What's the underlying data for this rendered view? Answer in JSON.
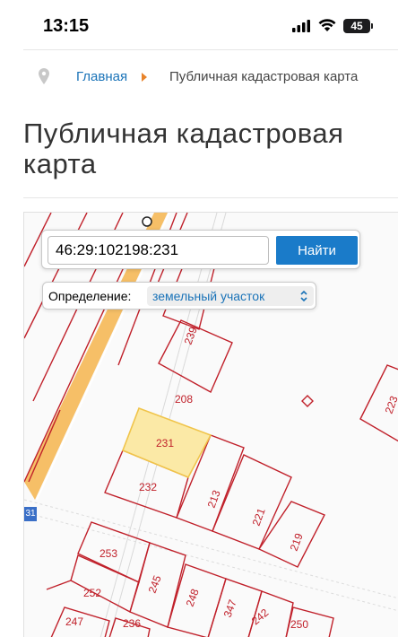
{
  "status": {
    "time": "13:15",
    "battery": "45"
  },
  "breadcrumb": {
    "home": "Главная",
    "current": "Публичная кадастровая карта"
  },
  "page": {
    "title": "Публичная кадастровая карта"
  },
  "search": {
    "value": "46:29:102198:231",
    "button": "Найти"
  },
  "definition": {
    "label": "Определение:",
    "value": "земельный участок"
  },
  "map": {
    "marker": "31",
    "parcels": {
      "p239": "239",
      "p208": "208",
      "p231": "231",
      "p232": "232",
      "p213": "213",
      "p221": "221",
      "p219": "219",
      "p253": "253",
      "p245": "245",
      "p252": "252",
      "p248": "248",
      "p347": "347",
      "p242": "242",
      "p250": "250",
      "p247": "247",
      "p236": "236",
      "p223": "223"
    },
    "colors": {
      "boundary": "#c0202a",
      "selected": "#fbe9a6",
      "road": "#f5b44c"
    }
  }
}
